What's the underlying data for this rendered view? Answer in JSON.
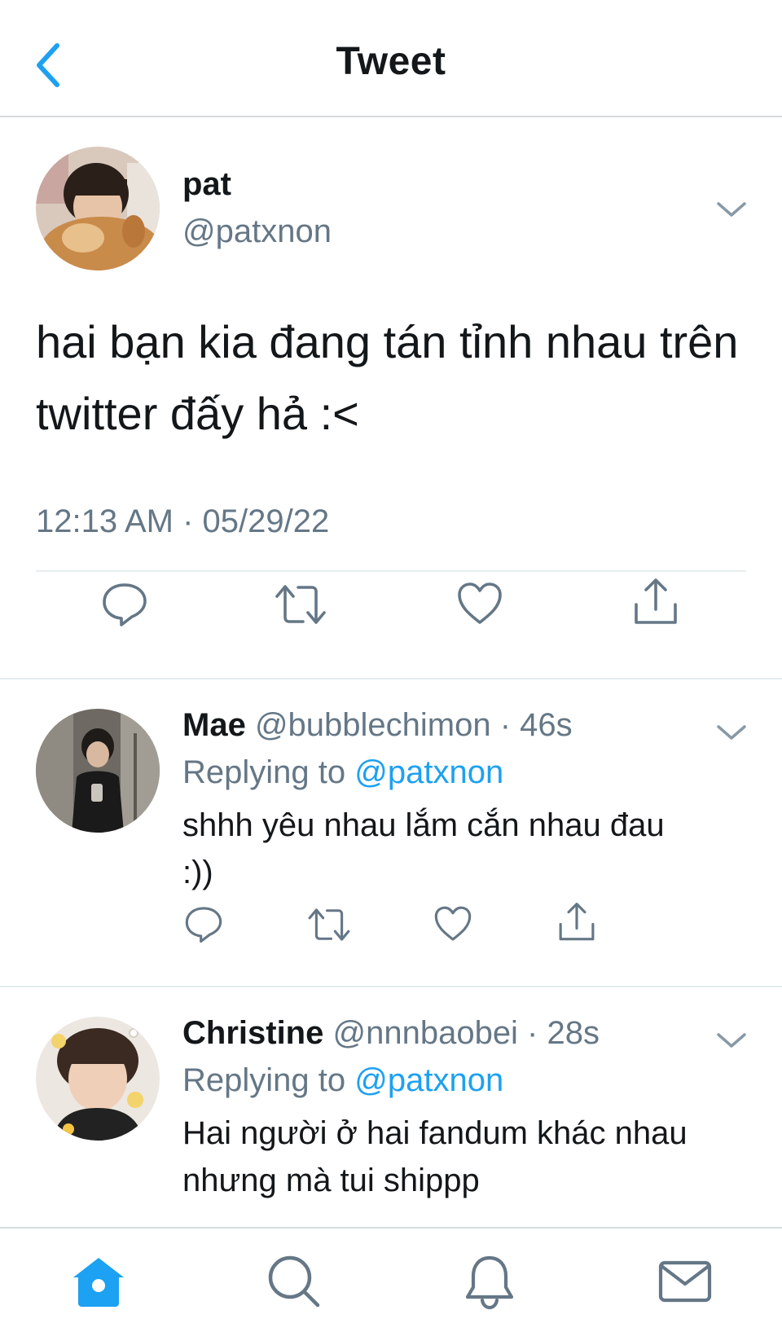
{
  "header": {
    "title": "Tweet",
    "back_icon": "chevron-left-icon"
  },
  "colors": {
    "accent": "#1da1f2",
    "secondary_text": "#657786",
    "primary_text": "#14171a",
    "divider": "#e6ecf0"
  },
  "main_tweet": {
    "name": "pat",
    "handle": "@patxnon",
    "text": "hai bạn kia đang tán tỉnh nhau trên twitter đấy hả :<",
    "timestamp": "12:13 AM · 05/29/22",
    "actions": [
      "reply-icon",
      "retweet-icon",
      "like-icon",
      "share-icon"
    ]
  },
  "replies": [
    {
      "name": "Mae",
      "handle_time": "@bubblechimon · 46s",
      "replying_prefix": "Replying to ",
      "replying_to": "@patxnon",
      "text": "shhh yêu nhau lắm cắn nhau đau :))"
    },
    {
      "name": "Christine",
      "handle_time": "@nnnbaobei · 28s",
      "replying_prefix": "Replying to ",
      "replying_to": "@patxnon",
      "text": "Hai người ở hai fandum khác nhau nhưng mà tui shippp"
    }
  ],
  "tabbar": {
    "tabs": [
      "home-icon",
      "search-icon",
      "notifications-icon",
      "messages-icon"
    ],
    "active": "home-icon"
  }
}
